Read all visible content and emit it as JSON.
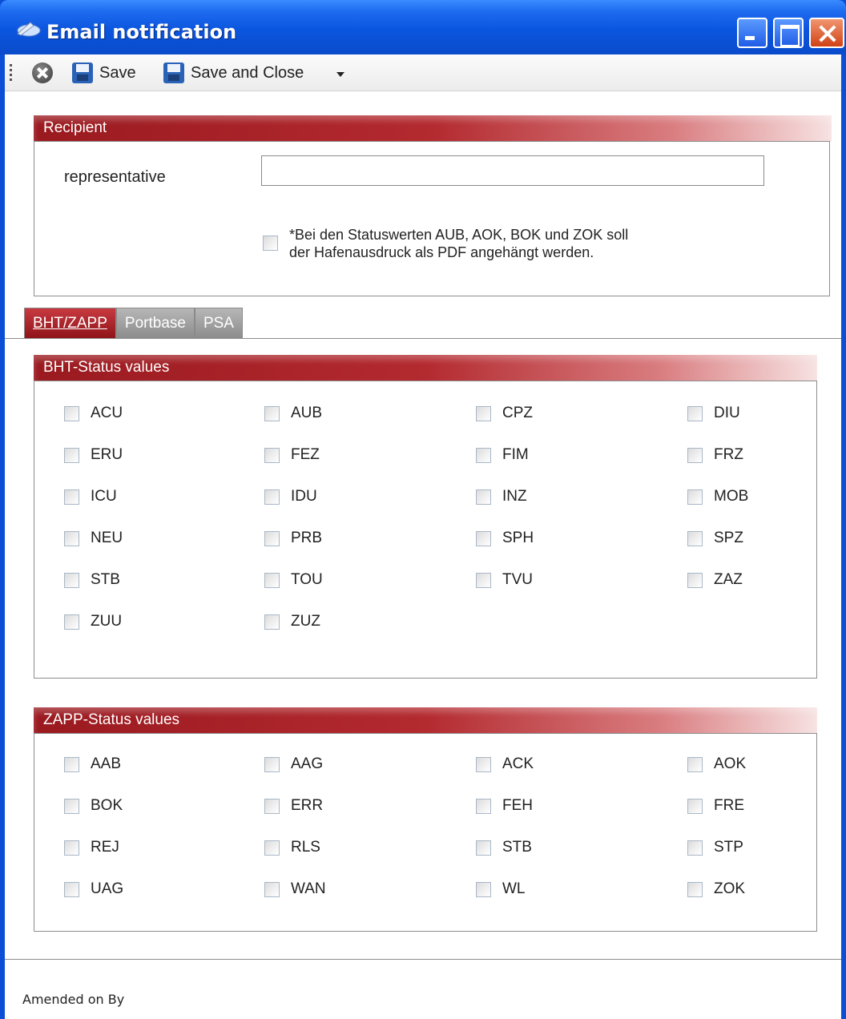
{
  "window": {
    "title": "Email notification"
  },
  "toolbar": {
    "save_label": "Save",
    "save_close_label": "Save and Close"
  },
  "recipient": {
    "header": "Recipient",
    "representative_label": "representative",
    "representative_value": "",
    "pdf_checkbox_text": "*Bei den Statuswerten AUB, AOK, BOK und  ZOK soll\nder Hafenausdruck als PDF angehängt werden.",
    "pdf_checked": false
  },
  "tabs": [
    {
      "label": "BHT/ZAPP",
      "active": true
    },
    {
      "label": "Portbase",
      "active": false
    },
    {
      "label": "PSA",
      "active": false
    }
  ],
  "bht": {
    "header": "BHT-Status values",
    "items": [
      "ACU",
      "AUB",
      "CPZ",
      "DIU",
      "ERU",
      "FEZ",
      "FIM",
      "FRZ",
      "ICU",
      "IDU",
      "INZ",
      "MOB",
      "NEU",
      "PRB",
      "SPH",
      "SPZ",
      "STB",
      "TOU",
      "TVU",
      "ZAZ",
      "ZUU",
      "ZUZ"
    ]
  },
  "zapp": {
    "header": "ZAPP-Status values",
    "items": [
      "AAB",
      "AAG",
      "ACK",
      "AOK",
      "BOK",
      "ERR",
      "FEH",
      "FRE",
      "REJ",
      "RLS",
      "STB",
      "STP",
      "UAG",
      "WAN",
      "WL",
      "ZOK"
    ]
  },
  "footer": {
    "text": "Amended on By"
  }
}
